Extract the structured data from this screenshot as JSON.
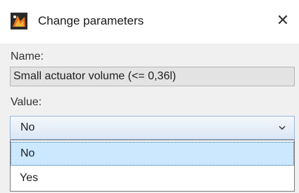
{
  "window": {
    "title": "Change parameters",
    "close_glyph": "✕"
  },
  "form": {
    "name_label": "Name:",
    "name_value": "Small actuator volume (<= 0,36l)",
    "value_label": "Value:",
    "selected_value": "No",
    "options": [
      "No",
      "Yes"
    ]
  },
  "icons": {
    "app": "app-logo-icon",
    "dropdown": "chevron-down-icon",
    "close": "close-icon"
  }
}
